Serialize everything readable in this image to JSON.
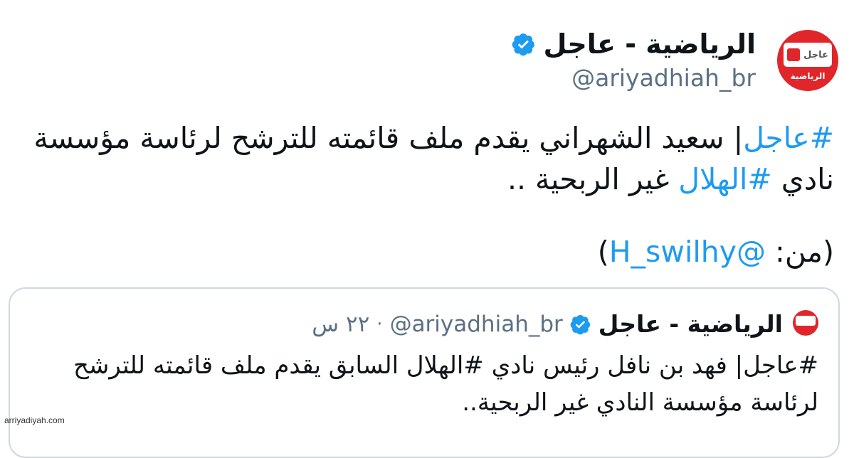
{
  "account": {
    "name": "الرياضية - عاجل",
    "handle": "@ariyadhiah_br",
    "avatar_word": "عاجل",
    "avatar_sub": "الرياضية"
  },
  "tweet": {
    "tag1": "#عاجل",
    "text1": "| سعيد الشهراني يقدم ملف قائمته للترشح لرئاسة مؤسسة نادي",
    "tag2": "#الهلال",
    "text2": " غير الربحية ..",
    "from_label": "(من: ",
    "from_mention": "@H_swilhy",
    "from_close": ")"
  },
  "quote": {
    "name": "الرياضية - عاجل",
    "handle": "@ariyadhiah_br",
    "dot": "·",
    "time": "٢٢ س",
    "text": "#عاجل| فهد بن نافل رئيس نادي #الهلال السابق يقدم ملف قائمته للترشح لرئاسة مؤسسة النادي غير الربحية.."
  },
  "watermark": "arriyadiyah.com",
  "colors": {
    "accent": "#1d9bf0",
    "brand_red": "#e0262a",
    "muted": "#5b7083"
  },
  "icons": {
    "verified": "verified-badge-icon"
  }
}
